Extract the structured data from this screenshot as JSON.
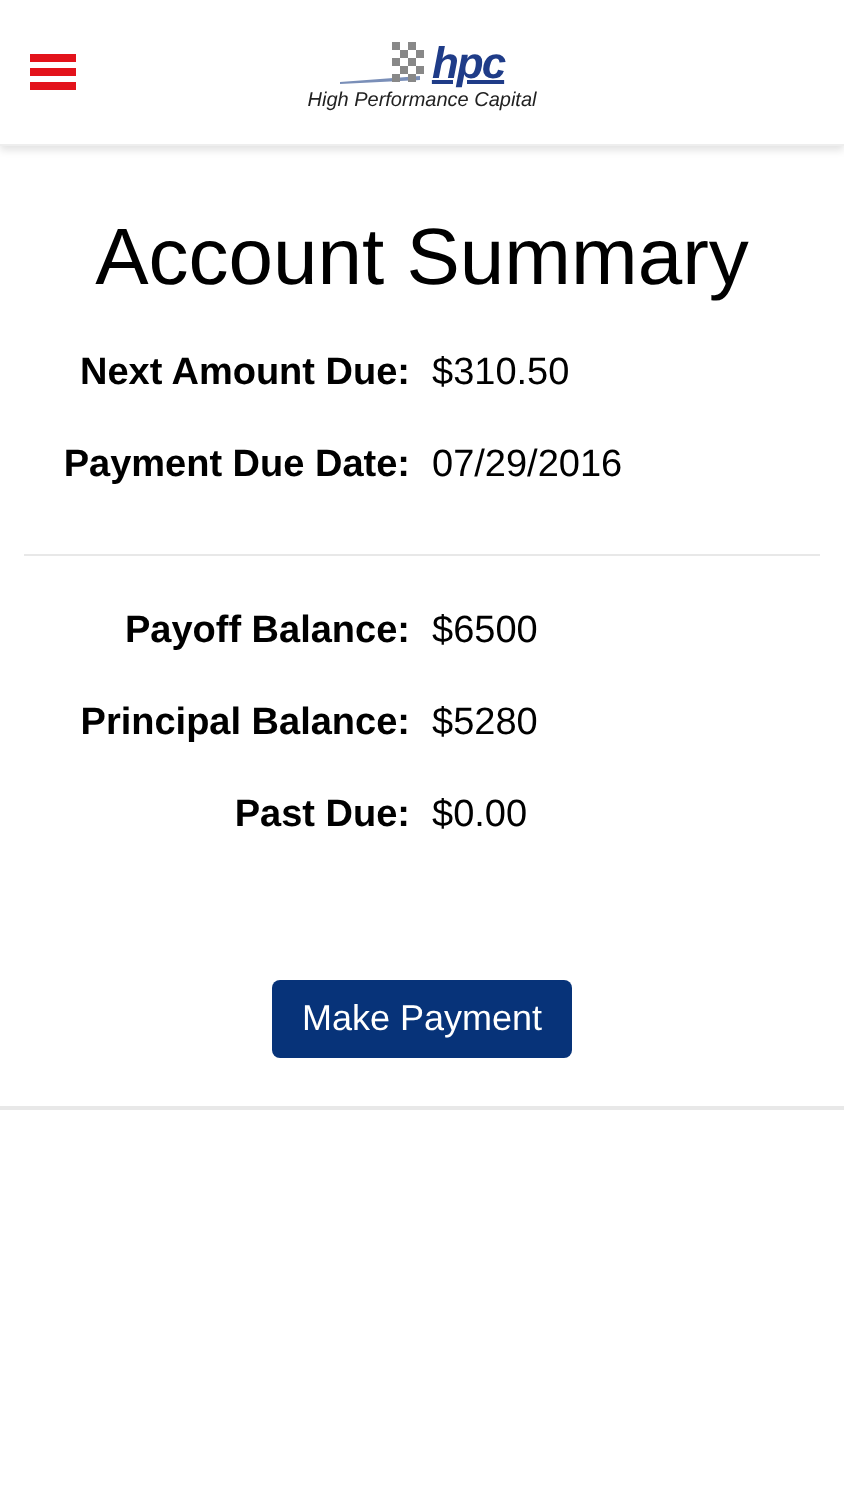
{
  "header": {
    "logo_mark": "hpc",
    "logo_caption": "High Performance Capital"
  },
  "title": "Account Summary",
  "sections": [
    {
      "rows": [
        {
          "label": "Next Amount Due:",
          "value": "$310.50"
        },
        {
          "label": "Payment Due Date:",
          "value": "07/29/2016"
        }
      ]
    },
    {
      "rows": [
        {
          "label": "Payoff Balance:",
          "value": "$6500"
        },
        {
          "label": "Principal Balance:",
          "value": "$5280"
        },
        {
          "label": "Past Due:",
          "value": "$0.00"
        }
      ]
    }
  ],
  "button": "Make Payment"
}
